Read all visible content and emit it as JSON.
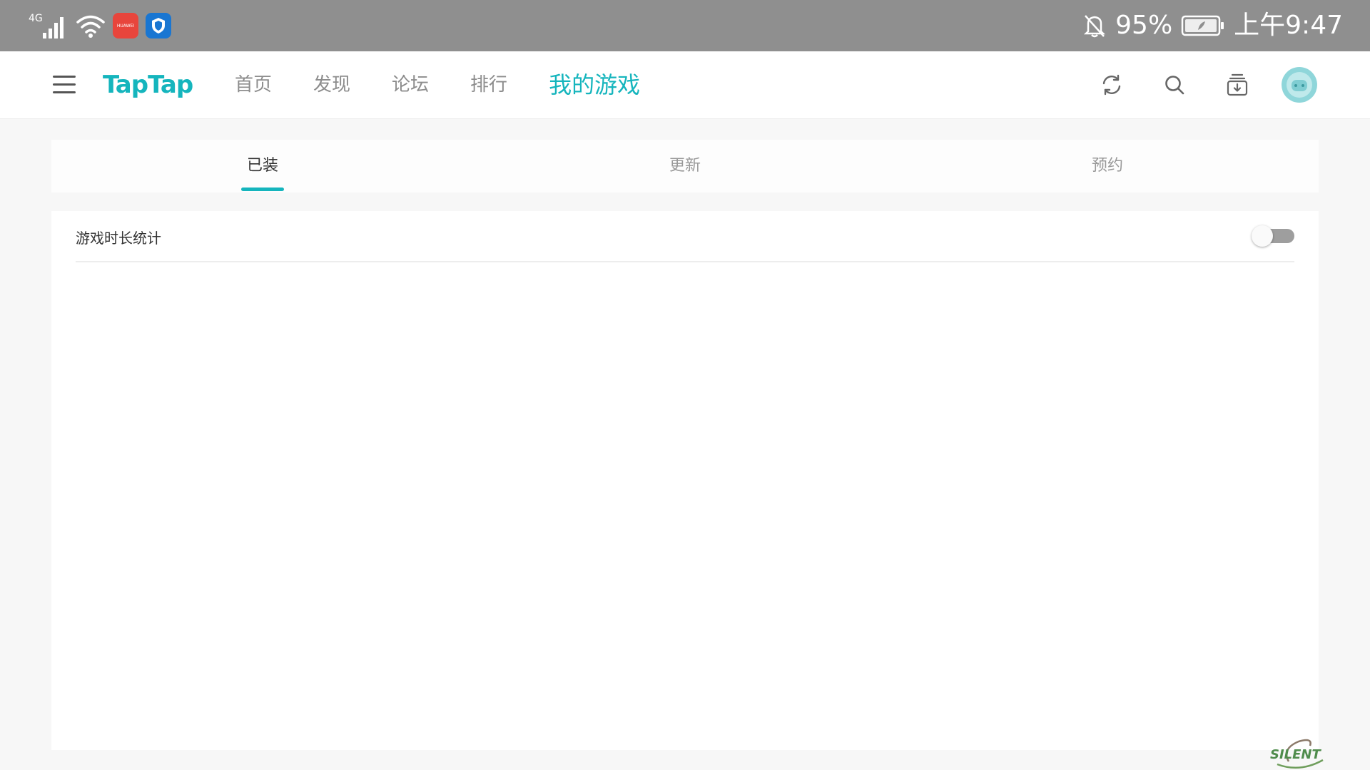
{
  "status_bar": {
    "network": "4G",
    "huawei_label": "HUAWEI",
    "battery": "95%",
    "time": "上午9:47"
  },
  "nav": {
    "logo": "TapTap",
    "tabs": [
      {
        "label": "首页"
      },
      {
        "label": "发现"
      },
      {
        "label": "论坛"
      },
      {
        "label": "排行"
      },
      {
        "label": "我的游戏",
        "active": true
      }
    ],
    "icons": [
      "refresh-icon",
      "search-icon",
      "download-manager-icon",
      "avatar"
    ]
  },
  "subtabs": [
    {
      "label": "已装",
      "active": true
    },
    {
      "label": "更新"
    },
    {
      "label": "预约"
    }
  ],
  "settings": {
    "playtime_label": "游戏时长统计",
    "playtime_enabled": false
  },
  "watermark": {
    "text": "SILENT"
  },
  "colors": {
    "accent": "#15b5bd",
    "status_bar": "#8f8f8f",
    "toggle_off": "#9e9e9e"
  }
}
